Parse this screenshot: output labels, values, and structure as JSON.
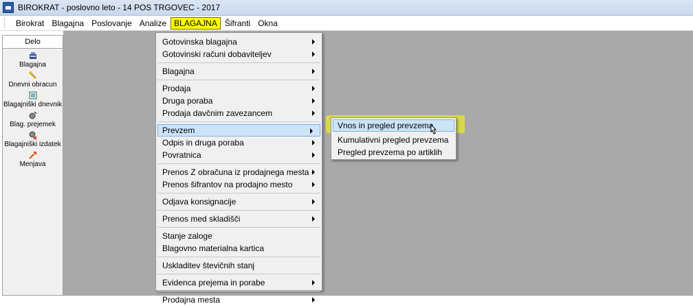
{
  "window": {
    "title": "BIROKRAT - poslovno leto - 14 POS TRGOVEC - 2017"
  },
  "menubar": {
    "items": [
      "Birokrat",
      "Blagajna",
      "Poslovanje",
      "Analize",
      "BLAGAJNA",
      "Šifranti",
      "Okna"
    ],
    "active_index": 4
  },
  "sidebar": {
    "header": "Delo",
    "items": [
      {
        "label": "Blagajna",
        "icon": "cash-register-icon"
      },
      {
        "label": "Dnevni obracun",
        "icon": "wrench-icon"
      },
      {
        "label": "Blagajniški dnevnik",
        "icon": "ledger-icon"
      },
      {
        "label": "Blag. prejemek",
        "icon": "receipt-in-icon"
      },
      {
        "label": "Blagajniški izdatek",
        "icon": "receipt-out-icon"
      },
      {
        "label": "Menjava",
        "icon": "exchange-icon"
      }
    ]
  },
  "dropdown": {
    "items": [
      "Gotovinska blagajna",
      "Gotovinski računi dobaviteljev",
      "Blagajna",
      "Prodaja",
      "Druga poraba",
      "Prodaja davčnim zavezancem",
      "Prevzem",
      "Odpis in druga poraba",
      "Povratnica",
      "Prenos Z obračuna iz prodajnega mesta",
      "Prenos šifrantov na prodajno mesto",
      "Odjava konsignacije",
      "Prenos med skladišči",
      "Stanje zaloge",
      "Blagovno materialna kartica",
      "Uskladitev števičnih stanj",
      "Evidenca prejema in porabe",
      "Prodajna mesta"
    ]
  },
  "submenu": {
    "items": [
      "Vnos in pregled prevzema",
      "Kumulativni pregled prevzema",
      "Pregled prevzema po artiklih"
    ]
  },
  "colors": {
    "highlight": "#ffff00",
    "selection": "#cce4f7",
    "workspace": "#a9a9a9"
  }
}
